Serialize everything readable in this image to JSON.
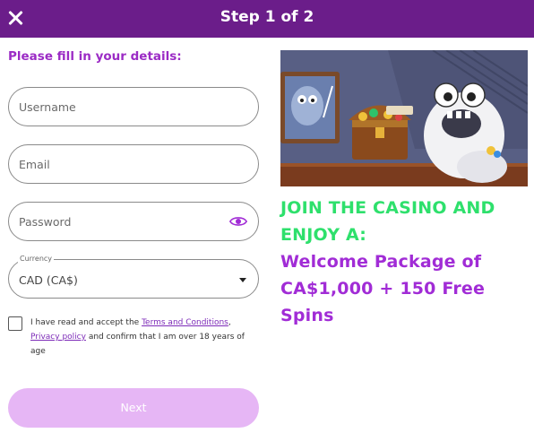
{
  "header": {
    "title": "Step 1 of 2"
  },
  "form": {
    "heading": "Please fill in your details:",
    "username": {
      "placeholder": "Username",
      "value": ""
    },
    "email": {
      "placeholder": "Email",
      "value": ""
    },
    "password": {
      "placeholder": "Password",
      "value": ""
    },
    "currency": {
      "label": "Currency",
      "value": "CAD (CA$)"
    },
    "terms": {
      "prefix": "I have read and accept the ",
      "terms_link": "Terms and Conditions",
      "comma": ",",
      "privacy_link": "Privacy policy",
      "suffix": " and confirm that I am over 18 years of age",
      "checked": false
    },
    "next_label": "Next"
  },
  "promo": {
    "line1": "JOIN THE CASINO AND ENJOY A:",
    "line2": "Welcome Package of CA$1,000 + 150 Free Spins"
  },
  "colors": {
    "header_bg": "#6b1d8a",
    "accent_purple": "#9b2bc5",
    "promo_green": "#2ee06c",
    "next_button_bg": "#e6b6f5"
  },
  "icons": [
    "close-icon",
    "eye-icon",
    "chevron-down-icon"
  ]
}
